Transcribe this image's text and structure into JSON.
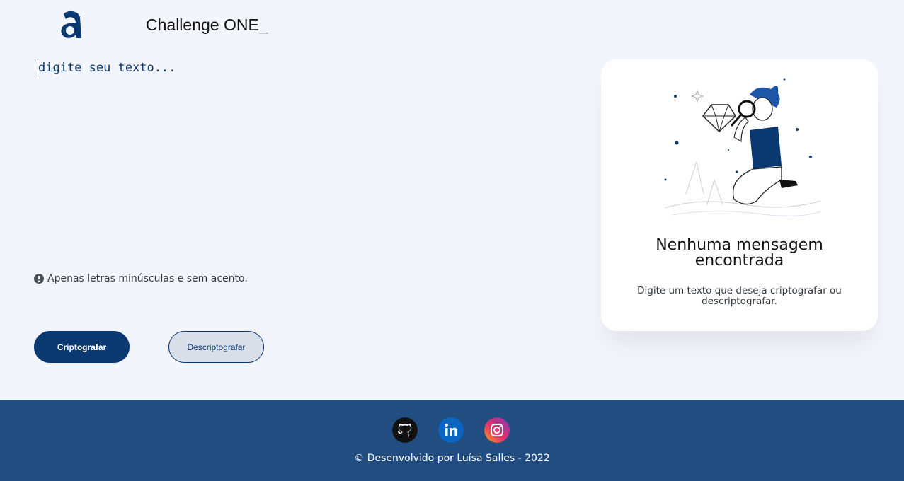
{
  "header": {
    "logo_icon": "alura-logo-icon",
    "title": "Challenge ONE",
    "title_cursor": "_"
  },
  "editor": {
    "placeholder": "digite seu texto..."
  },
  "hint": {
    "icon": "exclamation-circle-icon",
    "text": "Apenas letras minúsculas e sem acento."
  },
  "buttons": {
    "encrypt_label": "Criptografar",
    "decrypt_label": "Descriptografar"
  },
  "result_card": {
    "illustration": "person-with-magnifying-glass-illustration",
    "title_line1": "Nenhuma mensagem",
    "title_line2": "encontrada",
    "subtitle": "Digite um texto que deseja criptografar ou descriptografar."
  },
  "footer": {
    "social": [
      "github-icon",
      "linkedin-icon",
      "instagram-icon"
    ],
    "copyright": "© Desenvolvido por Luísa Salles - 2022"
  },
  "colors": {
    "primary": "#0a3871",
    "background": "#f3f5fc",
    "footer": "#224d80",
    "secondary_button": "#d8dfe8"
  }
}
